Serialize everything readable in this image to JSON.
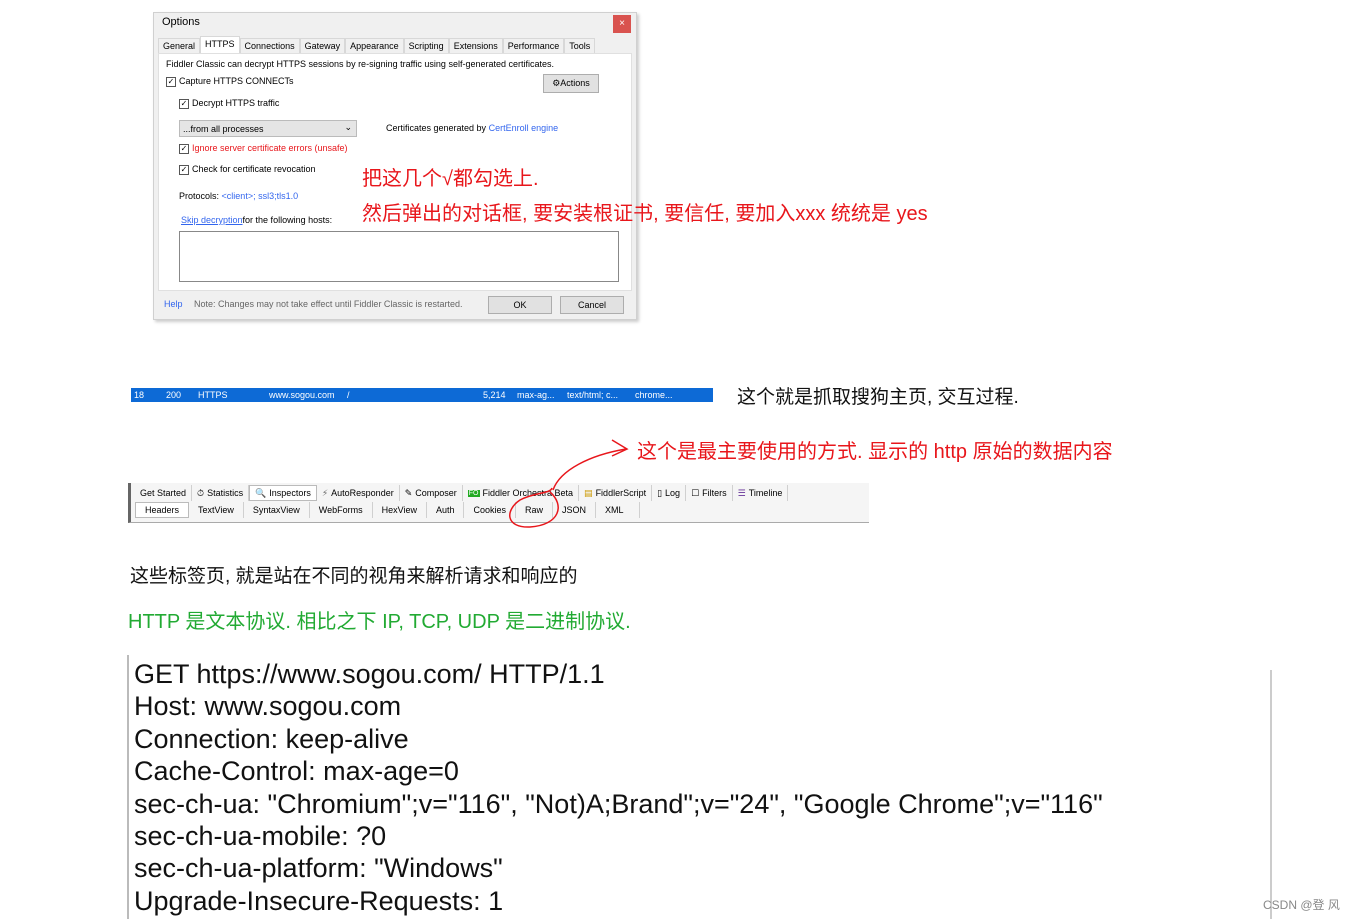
{
  "dialog": {
    "title": "Options",
    "close": "×",
    "tabs": [
      "General",
      "HTTPS",
      "Connections",
      "Gateway",
      "Appearance",
      "Scripting",
      "Extensions",
      "Performance",
      "Tools"
    ],
    "description": "Fiddler Classic can decrypt HTTPS sessions by re-signing traffic using self-generated certificates.",
    "capture": "Capture HTTPS CONNECTs",
    "actions": "Actions",
    "decrypt": "Decrypt HTTPS traffic",
    "process_select": "...from all processes",
    "cert_label": "Certificates generated by",
    "cert_link": "CertEnroll engine",
    "ignore": "Ignore server certificate errors (unsafe)",
    "revocation": "Check for certificate revocation",
    "protocols_label": "Protocols:",
    "protocols_value": "<client>; ssl3;tls1.0",
    "skip_link": "Skip decryption",
    "skip_rest": "for the following hosts:",
    "hosts_value": "",
    "help": "Help",
    "footer_note": "Note: Changes may not take effect until Fiddler Classic is restarted.",
    "ok": "OK",
    "cancel": "Cancel"
  },
  "annotations": {
    "check_all": "把这几个√都勾选上.",
    "install_cert": "然后弹出的对话框, 要安装根证书, 要信任, 要加入xxx 统统是 yes",
    "session_note": "这个就是抓取搜狗主页, 交互过程.",
    "raw_note": "这个是最主要使用的方式. 显示的 http 原始的数据内容"
  },
  "session_row": {
    "id": "18",
    "result": "200",
    "protocol": "HTTPS",
    "host": "www.sogou.com",
    "url": "/",
    "body": "5,214",
    "caching": "max-ag...",
    "content_type": "text/html; c...",
    "process": "chrome..."
  },
  "toolbar": {
    "tabs": [
      "Get Started",
      "Statistics",
      "Inspectors",
      "AutoResponder",
      "Composer",
      "Fiddler Orchestra Beta",
      "FiddlerScript",
      "Log",
      "Filters",
      "Timeline"
    ],
    "inspector_tabs": [
      "Headers",
      "TextView",
      "SyntaxView",
      "WebForms",
      "HexView",
      "Auth",
      "Cookies",
      "Raw",
      "JSON",
      "XML"
    ]
  },
  "paragraphs": {
    "tabs_desc": "这些标签页, 就是站在不同的视角来解析请求和响应的",
    "http_text": "HTTP 是文本协议. 相比之下 IP, TCP, UDP 是二进制协议."
  },
  "raw_lines": [
    "GET https://www.sogou.com/ HTTP/1.1",
    "Host: www.sogou.com",
    "Connection: keep-alive",
    "Cache-Control: max-age=0",
    "sec-ch-ua: \"Chromium\";v=\"116\", \"Not)A;Brand\";v=\"24\", \"Google Chrome\";v=\"116\"",
    "sec-ch-ua-mobile: ?0",
    "sec-ch-ua-platform: \"Windows\"",
    "Upgrade-Insecure-Requests: 1"
  ],
  "watermark": "CSDN @登 风",
  "colors": {
    "annotation_red": "#e8161b",
    "green": "#22aa33",
    "selection_blue": "#0d6ad6",
    "link": "#3366ee"
  }
}
